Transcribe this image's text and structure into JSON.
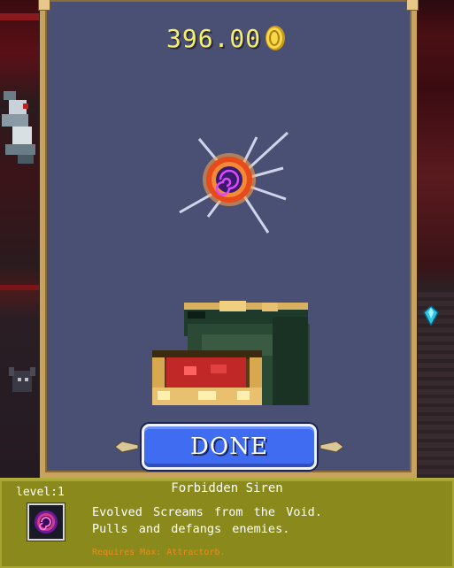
{
  "hud": {
    "gold_amount": "396.00",
    "coin_icon": "gold-coin-icon"
  },
  "treasure": {
    "item_icon": "void-orb-icon",
    "chest_icon": "treasure-chest-icon"
  },
  "done_button": {
    "label": "DONE"
  },
  "item_info": {
    "level_label": "level:1",
    "name": "Forbidden Siren",
    "description_line1": "Evolved Screams from the Void.",
    "description_line2": "Pulls and defangs enemies.",
    "requirement": "Requires Max: Attractorb."
  },
  "colors": {
    "panel_bg": "#4a4f74",
    "panel_border": "#c9a25e",
    "gold_text": "#f6ef6e",
    "button_blue": "#3f6cf0",
    "info_bg": "#8a8a1c",
    "requirement_text": "#f08a1a"
  }
}
